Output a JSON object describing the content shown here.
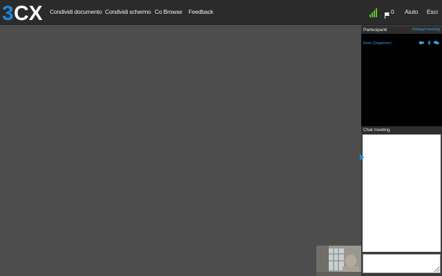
{
  "app": {
    "logo_text": "3CX",
    "brand_color": "#1e88d6"
  },
  "nav": {
    "items": [
      {
        "label": "Condividi documento",
        "icon": null
      },
      {
        "label": "Condividi schermo",
        "icon": null
      },
      {
        "label": "Co Browse",
        "icon": null
      },
      {
        "label": "Feedback",
        "icon": null
      }
    ]
  },
  "status": {
    "signal_icon": "signal-bars-icon",
    "signal_color": "#5cc42e",
    "flag_icon": "flag-icon",
    "flag_count": "0",
    "help_label": "Aiuto",
    "exit_label": "Esci"
  },
  "participants": {
    "header": "Partecipanti",
    "details_link": "Dettagli meeting",
    "list": [
      {
        "name": "Root (Organizer)",
        "icons": [
          "camera-icon",
          "microphone-icon",
          "chat-icon"
        ]
      }
    ]
  },
  "chat": {
    "header": "Chat meeting",
    "input_value": ""
  },
  "video": {
    "self_view_icon": "webcam-preview"
  }
}
